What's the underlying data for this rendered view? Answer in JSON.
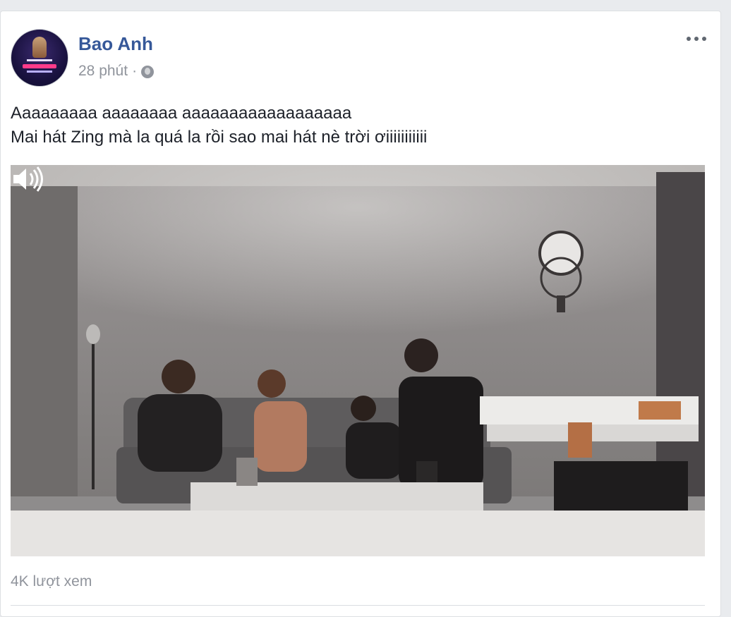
{
  "post": {
    "author": "Bao Anh",
    "time": "28 phút",
    "separator": "·",
    "privacy_icon": "globe-icon",
    "text_line1": "Aaaaaaaaa aaaaaaaa aaaaaaaaaaaaaaaaaa",
    "text_line2": "Mai hát Zing mà la quá la rồi sao mai hát nè trời ơiiiiiiiiiii",
    "views": "4K lượt xem",
    "more_icon": "more-options-icon"
  },
  "video": {
    "volume_icon": "volume-icon"
  },
  "colors": {
    "author_link": "#365899",
    "meta_text": "#90949c",
    "body_text": "#1d2129",
    "page_bg": "#e9ebee"
  }
}
